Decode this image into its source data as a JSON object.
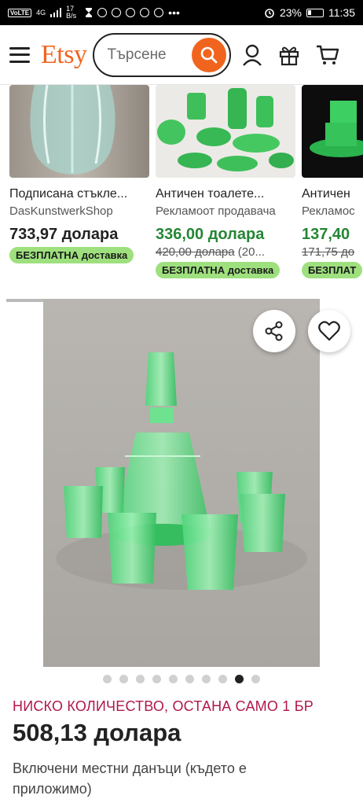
{
  "status_bar": {
    "carrier": "VoLTE",
    "signal": "4G",
    "speed": "17 B/s",
    "battery": "23%",
    "time": "11:35"
  },
  "header": {
    "logo": "Etsy",
    "search_placeholder": "Търсене"
  },
  "carousel": [
    {
      "title": "Подписана стъкле...",
      "shop": "DasKunstwerkShop",
      "price": "733,97 долара",
      "old_price": "",
      "badge": "БЕЗПЛАТНА доставка"
    },
    {
      "title": "Античен тоалете...",
      "shop": "Рекламоот продавача",
      "price": "336,00 долара",
      "old_price": "420,00 долара",
      "old_suffix": "(20...",
      "badge": "БЕЗПЛАТНА доставка"
    },
    {
      "title": "Античен",
      "shop": "Рекламос",
      "price": "137,40",
      "old_price": "171,75 до",
      "badge": "БЕЗПЛАТ"
    }
  ],
  "listing": {
    "image_count": 10,
    "active_image": 8,
    "stock_text": "НИСКО КОЛИЧЕСТВО, ОСТАНА САМО 1 БР",
    "price": "508,13 долара",
    "tax_note": "Включени местни данъци (където е приложимо)"
  },
  "colors": {
    "brand": "#f1641e",
    "sale_price": "#258635",
    "badge": "#9ee07e",
    "stock": "#b0174c"
  }
}
